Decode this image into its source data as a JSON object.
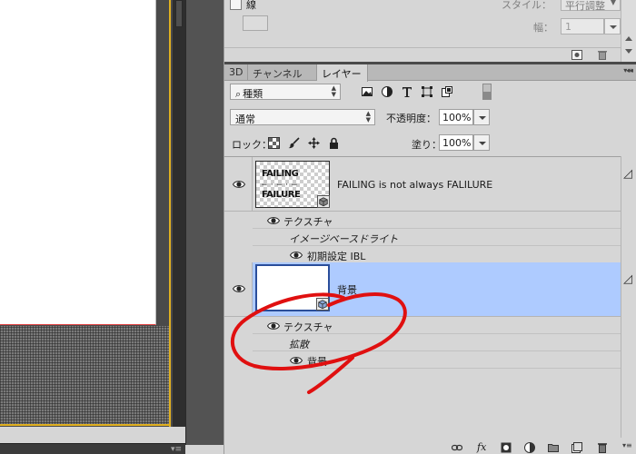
{
  "properties": {
    "stroke_label": "線",
    "style_label": "スタイル：",
    "style_value": "平行調整",
    "width_label": "幅：",
    "width_value": "1"
  },
  "tabs": [
    {
      "label": "3D",
      "active": false
    },
    {
      "label": "チャンネル",
      "active": false
    },
    {
      "label": "レイヤー",
      "active": true
    }
  ],
  "toolbar": {
    "kind_filter": "種類",
    "blend_mode": "通常",
    "opacity_label": "不透明度：",
    "opacity_value": "100%",
    "lock_label": "ロック：",
    "fill_label": "塗り：",
    "fill_value": "100%"
  },
  "layers": [
    {
      "name": "FAILING is not always FALILURE",
      "thumb_text": "FAILING\n- - -\nFAILURE",
      "selected": false,
      "sublayers": [
        {
          "label": "テクスチャ",
          "icon": "eye-icon"
        },
        {
          "label": "イメージベースドライト",
          "icon": null
        },
        {
          "label": "初期設定 IBL",
          "icon": "eye-icon"
        }
      ]
    },
    {
      "name": "背景",
      "selected": true,
      "sublayers": [
        {
          "label": "テクスチャ",
          "icon": "eye-icon"
        },
        {
          "label": "拡散",
          "icon": null
        },
        {
          "label": "背景",
          "icon": "eye-icon"
        }
      ]
    }
  ],
  "bottom_bar": {
    "icons": [
      "link-icon",
      "fx-icon",
      "mask-icon",
      "adjustment-icon",
      "group-icon",
      "new-layer-icon",
      "trash-icon"
    ]
  },
  "colors": {
    "panel_bg": "#d6d6d6",
    "selected_row": "#aecbff",
    "canvas_frame": "#e0b020",
    "annotation": "#e01010"
  }
}
